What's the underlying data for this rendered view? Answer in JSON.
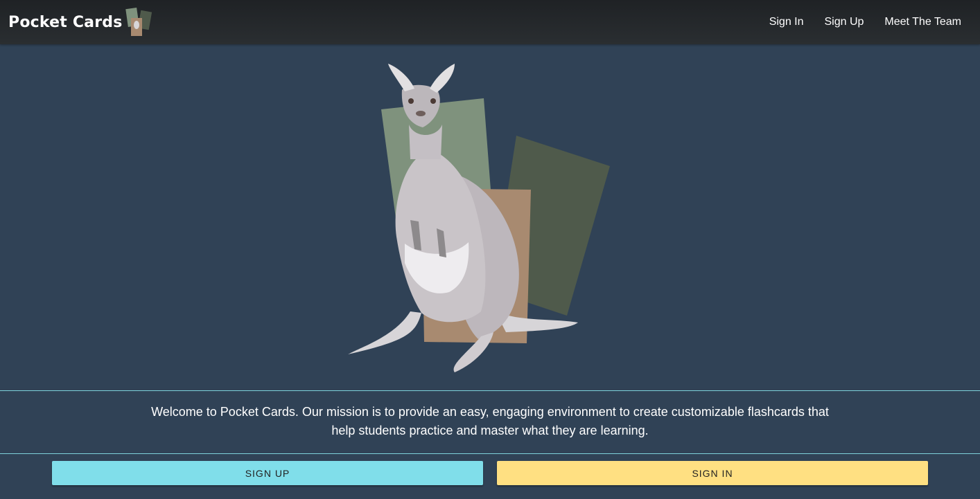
{
  "header": {
    "brand": "Pocket Cards",
    "nav": [
      {
        "label": "Sign In"
      },
      {
        "label": "Sign Up"
      },
      {
        "label": "Meet The Team"
      }
    ]
  },
  "main": {
    "hero_icon": "kangaroo-illustration",
    "mission": "Welcome to Pocket Cards. Our mission is to provide an easy, engaging environment to create customizable flashcards that help students practice and master what they are learning."
  },
  "actions": {
    "signup_label": "SIGN UP",
    "signin_label": "SIGN IN"
  },
  "colors": {
    "navbar": "#23272a",
    "background": "#304256",
    "signup_button": "#80deea",
    "signin_button": "#ffe082",
    "divider": "#7fd3dd",
    "card_green": "#7f927d",
    "card_dark_green": "#4f5a4b",
    "card_tan": "#a88a70"
  }
}
